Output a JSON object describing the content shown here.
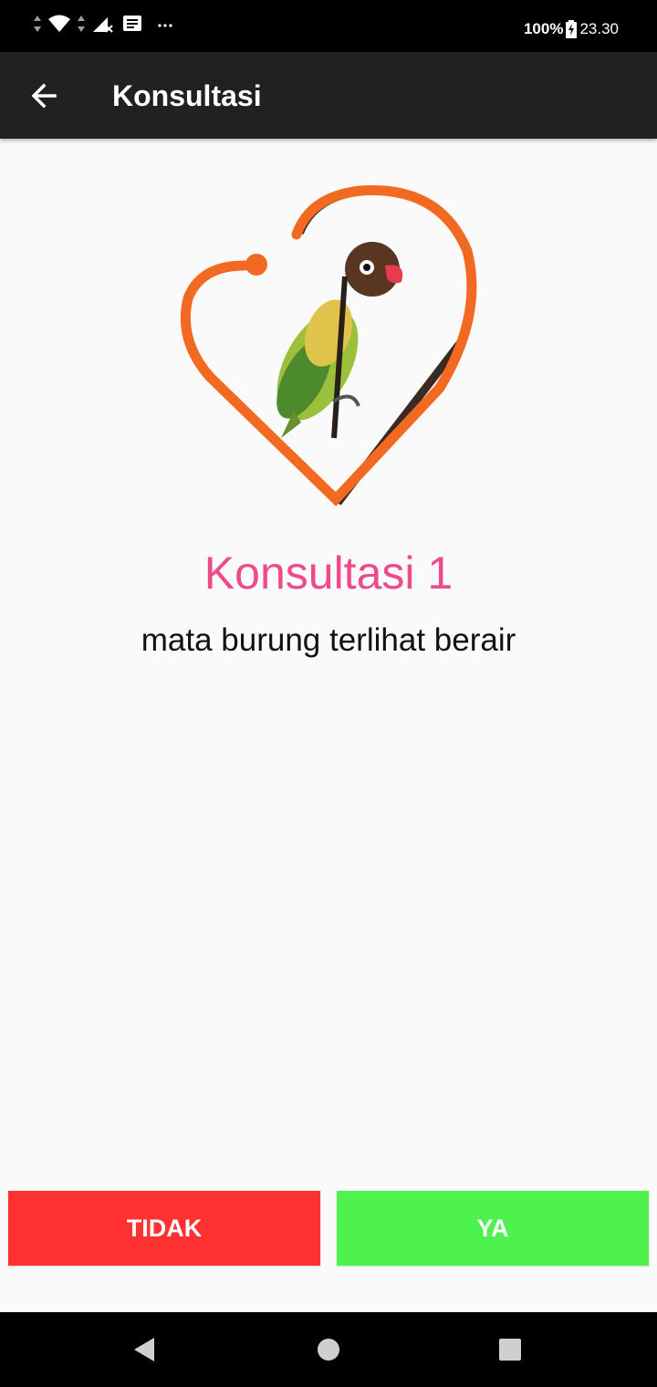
{
  "status_bar": {
    "battery": "100%",
    "time": "23.30",
    "icons": [
      "data-arrows-icon",
      "wifi-icon",
      "signal-off-icon",
      "message-notification-icon",
      "more-notifications-icon",
      "battery-charging-icon"
    ]
  },
  "toolbar": {
    "back_icon": "arrow-left-icon",
    "title": "Konsultasi"
  },
  "logo": {
    "icon": "heart-stethoscope-bird-logo",
    "accent_color": "#f26a21"
  },
  "question": {
    "title": "Konsultasi 1",
    "text": "mata burung terlihat berair",
    "title_color": "#ef4b8a"
  },
  "buttons": {
    "no_label": "TIDAK",
    "yes_label": "YA",
    "no_color": "#ff3131",
    "yes_color": "#4df24d"
  },
  "nav_bar": {
    "icons": [
      "back-triangle-icon",
      "home-circle-icon",
      "recents-square-icon"
    ]
  }
}
